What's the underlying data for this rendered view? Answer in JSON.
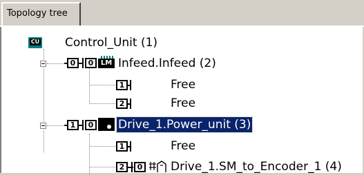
{
  "tab": {
    "label": "Topology tree"
  },
  "nodes": {
    "cu": {
      "label": "Control_Unit (1)",
      "icon_text": "CU"
    },
    "infeed": {
      "label": "Infeed.Infeed (2)",
      "port_a": "0",
      "port_b": "0",
      "icon_text": "LM"
    },
    "infeed_p1": {
      "label": "Free",
      "port": "1"
    },
    "infeed_p2": {
      "label": "Free",
      "port": "2"
    },
    "drive": {
      "label": "Drive_1.Power_unit (3)",
      "port_a": "1",
      "port_b": "0"
    },
    "drive_p1": {
      "label": "Free",
      "port": "1"
    },
    "encoder": {
      "label": "Drive_1.SM_to_Encoder_1 (4)",
      "port_a": "2",
      "port_b": "0"
    }
  },
  "colors": {
    "selection": "#0a246a",
    "cu_icon": "#008080"
  }
}
